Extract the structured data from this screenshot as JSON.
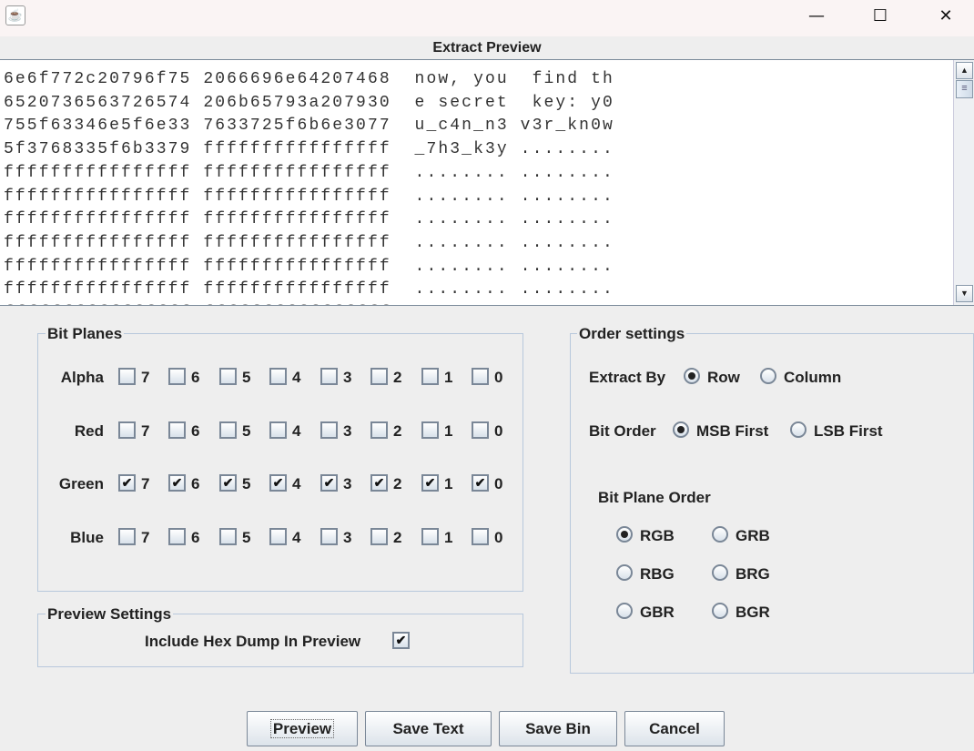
{
  "window": {
    "title": "Extract Preview",
    "app_icon": "java-icon",
    "minimize": "—",
    "maximize": "☐",
    "close": "✕"
  },
  "preview": {
    "lines": [
      "6e6f772c20796f75 2066696e64207468  now, you  find th",
      "6520736563726574 206b65793a207930  e secret  key: y0",
      "755f63346e5f6e33 7633725f6b6e3077  u_c4n_n3 v3r_kn0w",
      "5f3768335f6b3379 ffffffffffffffff  _7h3_k3y ........",
      "ffffffffffffffff ffffffffffffffff  ........ ........",
      "ffffffffffffffff ffffffffffffffff  ........ ........",
      "ffffffffffffffff ffffffffffffffff  ........ ........",
      "ffffffffffffffff ffffffffffffffff  ........ ........",
      "ffffffffffffffff ffffffffffffffff  ........ ........",
      "ffffffffffffffff ffffffffffffffff  ........ ........",
      "ffffffffffffffff ffffffffffffffff  ........ ........"
    ]
  },
  "bit_planes": {
    "title": "Bit Planes",
    "bits": [
      "7",
      "6",
      "5",
      "4",
      "3",
      "2",
      "1",
      "0"
    ],
    "channels": [
      {
        "name": "Alpha",
        "checked": [
          false,
          false,
          false,
          false,
          false,
          false,
          false,
          false
        ]
      },
      {
        "name": "Red",
        "checked": [
          false,
          false,
          false,
          false,
          false,
          false,
          false,
          false
        ]
      },
      {
        "name": "Green",
        "checked": [
          true,
          true,
          true,
          true,
          true,
          true,
          true,
          true
        ]
      },
      {
        "name": "Blue",
        "checked": [
          false,
          false,
          false,
          false,
          false,
          false,
          false,
          false
        ]
      }
    ]
  },
  "preview_settings": {
    "title": "Preview Settings",
    "include_hex_label": "Include Hex Dump In Preview",
    "include_hex": true
  },
  "order": {
    "title": "Order settings",
    "extract_by_label": "Extract By",
    "row": "Row",
    "column": "Column",
    "extract_by": "Row",
    "bit_order_label": "Bit Order",
    "msb": "MSB First",
    "lsb": "LSB First",
    "bit_order": "MSB First",
    "plane_order_label": "Bit Plane Order",
    "plane_options": [
      "RGB",
      "GRB",
      "RBG",
      "BRG",
      "GBR",
      "BGR"
    ],
    "plane_order": "RGB"
  },
  "buttons": {
    "preview": "Preview",
    "save_text": "Save Text",
    "save_bin": "Save Bin",
    "cancel": "Cancel"
  }
}
